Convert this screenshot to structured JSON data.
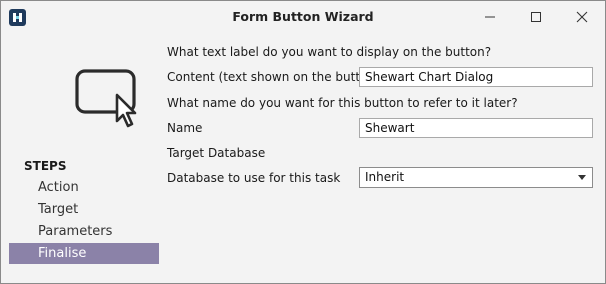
{
  "window": {
    "title": "Form Button Wizard"
  },
  "icons": {
    "app": "app-logo-icon",
    "minimize": "minimize-icon",
    "maximize": "maximize-icon",
    "close": "close-icon",
    "illustration": "button-cursor-icon",
    "dropdown": "chevron-down-icon"
  },
  "sidebar": {
    "title": "STEPS",
    "items": [
      {
        "label": "Action"
      },
      {
        "label": "Target"
      },
      {
        "label": "Parameters"
      },
      {
        "label": "Finalise",
        "active": true
      }
    ]
  },
  "form": {
    "q1": "What text label do you want to display on the button?",
    "content_label": "Content (text shown on the button)",
    "content_value": "Shewart Chart Dialog",
    "q2": "What name do you want for this button to refer to it later?",
    "name_label": "Name",
    "name_value": "Shewart",
    "target_db_heading": "Target Database",
    "database_label": "Database to use for this task",
    "database_value": "Inherit"
  },
  "colors": {
    "active_step": "#8b82a8",
    "app_icon": "#1f3a5c"
  }
}
